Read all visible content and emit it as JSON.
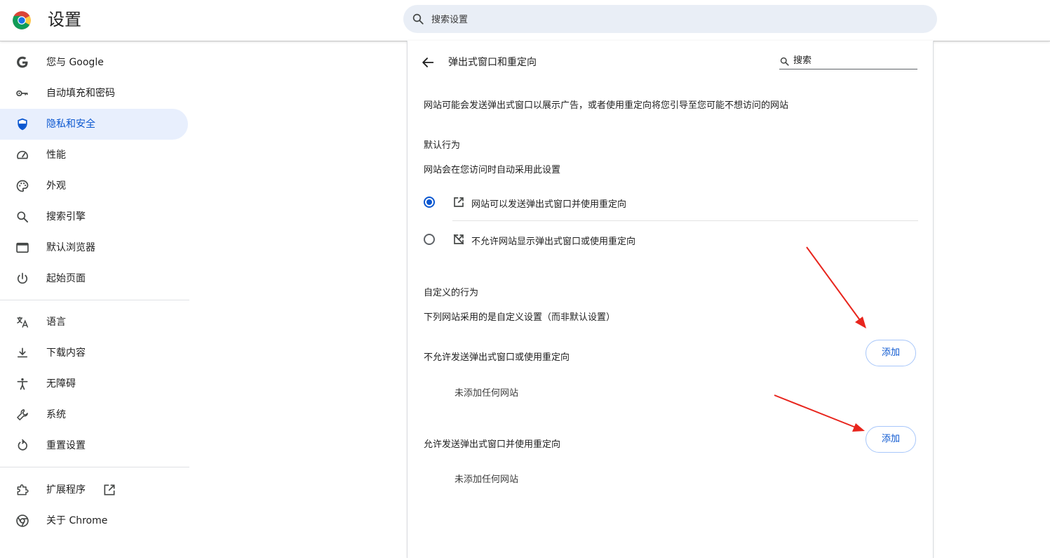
{
  "header": {
    "title": "设置",
    "search_placeholder": "搜索设置",
    "logo_icon": "chrome-logo-icon"
  },
  "sidebar": {
    "items": [
      {
        "label": "您与 Google",
        "icon": "google-g-icon",
        "active": false
      },
      {
        "label": "自动填充和密码",
        "icon": "key-icon",
        "active": false
      },
      {
        "label": "隐私和安全",
        "icon": "shield-icon",
        "active": true
      },
      {
        "label": "性能",
        "icon": "speedometer-icon",
        "active": false
      },
      {
        "label": "外观",
        "icon": "palette-icon",
        "active": false
      },
      {
        "label": "搜索引擎",
        "icon": "search-icon",
        "active": false
      },
      {
        "label": "默认浏览器",
        "icon": "browser-window-icon",
        "active": false
      },
      {
        "label": "起始页面",
        "icon": "power-icon",
        "active": false
      },
      {
        "label": "语言",
        "icon": "translate-icon",
        "active": false
      },
      {
        "label": "下载内容",
        "icon": "download-icon",
        "active": false
      },
      {
        "label": "无障碍",
        "icon": "accessibility-icon",
        "active": false
      },
      {
        "label": "系统",
        "icon": "wrench-icon",
        "active": false
      },
      {
        "label": "重置设置",
        "icon": "reset-icon",
        "active": false
      },
      {
        "label": "扩展程序",
        "icon": "puzzle-icon",
        "active": false
      },
      {
        "label": "关于 Chrome",
        "icon": "chrome-outline-icon",
        "active": false
      }
    ]
  },
  "main": {
    "title": "弹出式窗口和重定向",
    "search_placeholder": "搜索",
    "description": "网站可能会发送弹出式窗口以展示广告，或者使用重定向将您引导至您可能不想访问的网站",
    "default_behavior": {
      "heading": "默认行为",
      "subheading": "网站会在您访问时自动采用此设置",
      "options": [
        {
          "label": "网站可以发送弹出式窗口并使用重定向",
          "icon": "open-in-new-icon",
          "checked": true
        },
        {
          "label": "不允许网站显示弹出式窗口或使用重定向",
          "icon": "popup-blocked-icon",
          "checked": false
        }
      ]
    },
    "custom_behavior": {
      "heading": "自定义的行为",
      "subheading": "下列网站采用的是自定义设置（而非默认设置）",
      "sections": [
        {
          "label": "不允许发送弹出式窗口或使用重定向",
          "button": "添加",
          "empty_text": "未添加任何网站"
        },
        {
          "label": "允许发送弹出式窗口并使用重定向",
          "button": "添加",
          "empty_text": "未添加任何网站"
        }
      ]
    }
  },
  "colors": {
    "accent": "#0b57d0",
    "active_bg": "#e8effd",
    "annotation_arrow": "#e8251d"
  }
}
